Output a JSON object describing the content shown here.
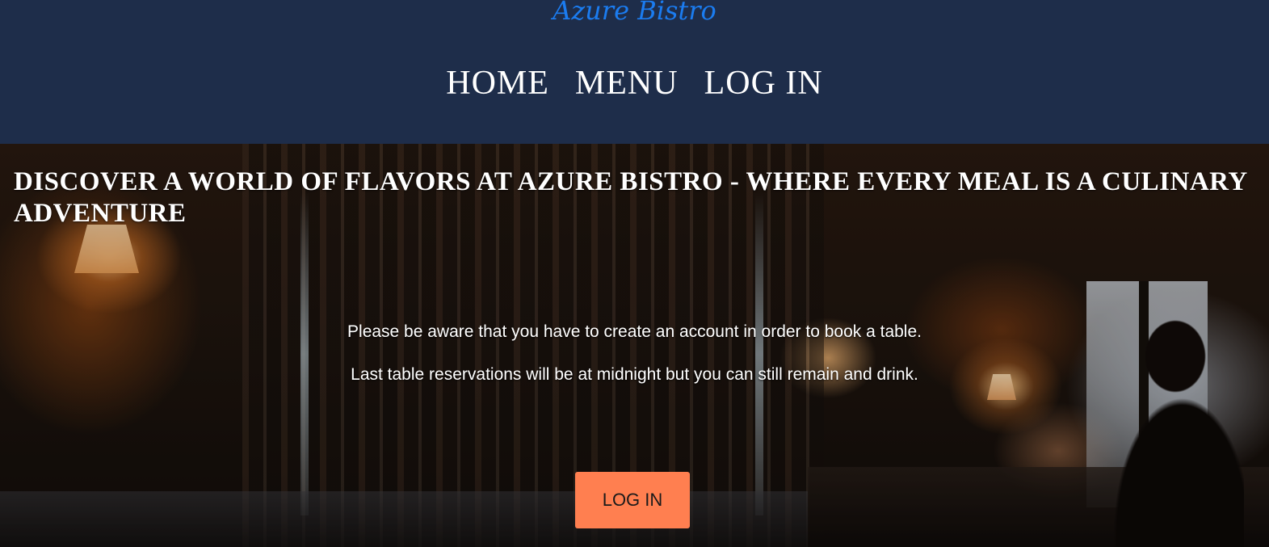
{
  "header": {
    "brand": "Azure Bistro",
    "nav": [
      {
        "label": "HOME"
      },
      {
        "label": "MENU"
      },
      {
        "label": "LOG IN"
      }
    ]
  },
  "hero": {
    "title": "DISCOVER A WORLD OF FLAVORS AT AZURE BISTRO - WHERE EVERY MEAL IS A CULINARY ADVENTURE",
    "notices": [
      "Please be aware that you have to create an account in order to book a table.",
      "Last table reservations will be at midnight but you can still remain and drink."
    ],
    "cta_label": "LOG IN"
  },
  "colors": {
    "header_bg": "#1e2d4a",
    "brand": "#1b7cf0",
    "cta_bg": "#ff7f50"
  }
}
